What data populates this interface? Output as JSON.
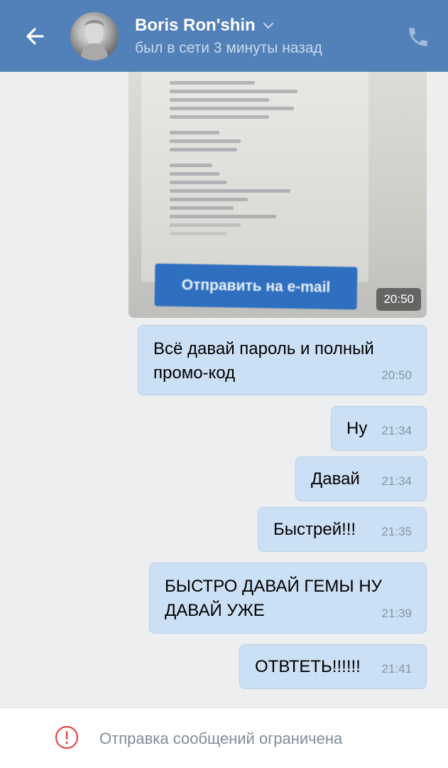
{
  "header": {
    "name": "Boris Ron'shin",
    "status": "был в сети 3 минуты назад",
    "icons": {
      "back": "arrow-left-icon",
      "dropdown": "chevron-down-icon",
      "call": "phone-icon"
    },
    "background_color": "#5181b8"
  },
  "photo_message": {
    "button_text": "Отправить на e-mail",
    "time": "20:50"
  },
  "messages": [
    {
      "text_lines": [
        "Всё давай пароль и полный",
        "промо-код"
      ],
      "time": "20:50"
    },
    {
      "text_lines": [
        "Ну"
      ],
      "time": "21:34"
    },
    {
      "text_lines": [
        "Давай"
      ],
      "time": "21:34"
    },
    {
      "text_lines": [
        "Быстрей!!!"
      ],
      "time": "21:35"
    },
    {
      "text_lines": [
        "БЫСТРО ДАВАЙ ГЕМЫ НУ",
        "ДАВАЙ УЖЕ"
      ],
      "time": "21:39"
    },
    {
      "text_lines": [
        "ОТВТЕТЬ!!!!!!"
      ],
      "time": "21:41"
    }
  ],
  "footer": {
    "notice": "Отправка сообщений ограничена",
    "icon": "warning-circle-icon",
    "icon_color": "#e64646"
  },
  "colors": {
    "bubble": "#cce0f5",
    "background": "#edeef0"
  }
}
